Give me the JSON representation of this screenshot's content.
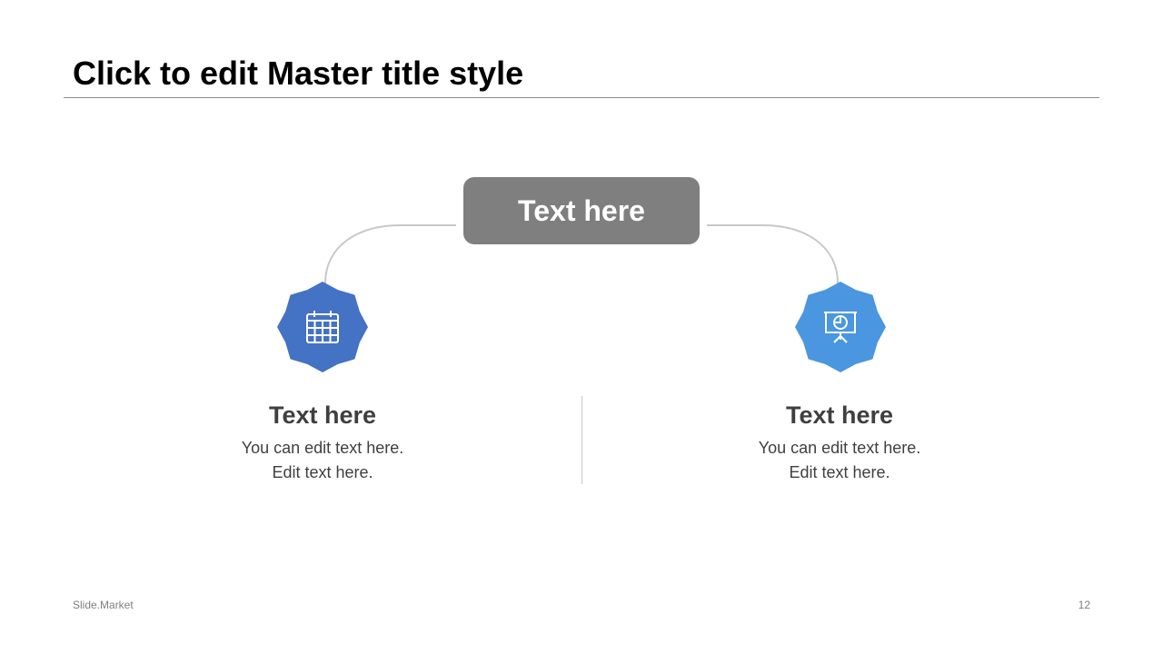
{
  "slide": {
    "title": "Click to edit Master title style",
    "footer": {
      "brand": "Slide.Market",
      "page_number": "12"
    }
  },
  "diagram": {
    "center": {
      "label": "Text here",
      "color": "#7f7f7f"
    },
    "items": [
      {
        "heading": "Text here",
        "line1": "You can edit text here.",
        "line2": "Edit text here.",
        "icon": "calendar-icon",
        "color": "#4472c4"
      },
      {
        "heading": "Text here",
        "line1": "You can edit text here.",
        "line2": "Edit text here.",
        "icon": "presentation-board-icon",
        "color": "#4a96e0"
      }
    ]
  }
}
